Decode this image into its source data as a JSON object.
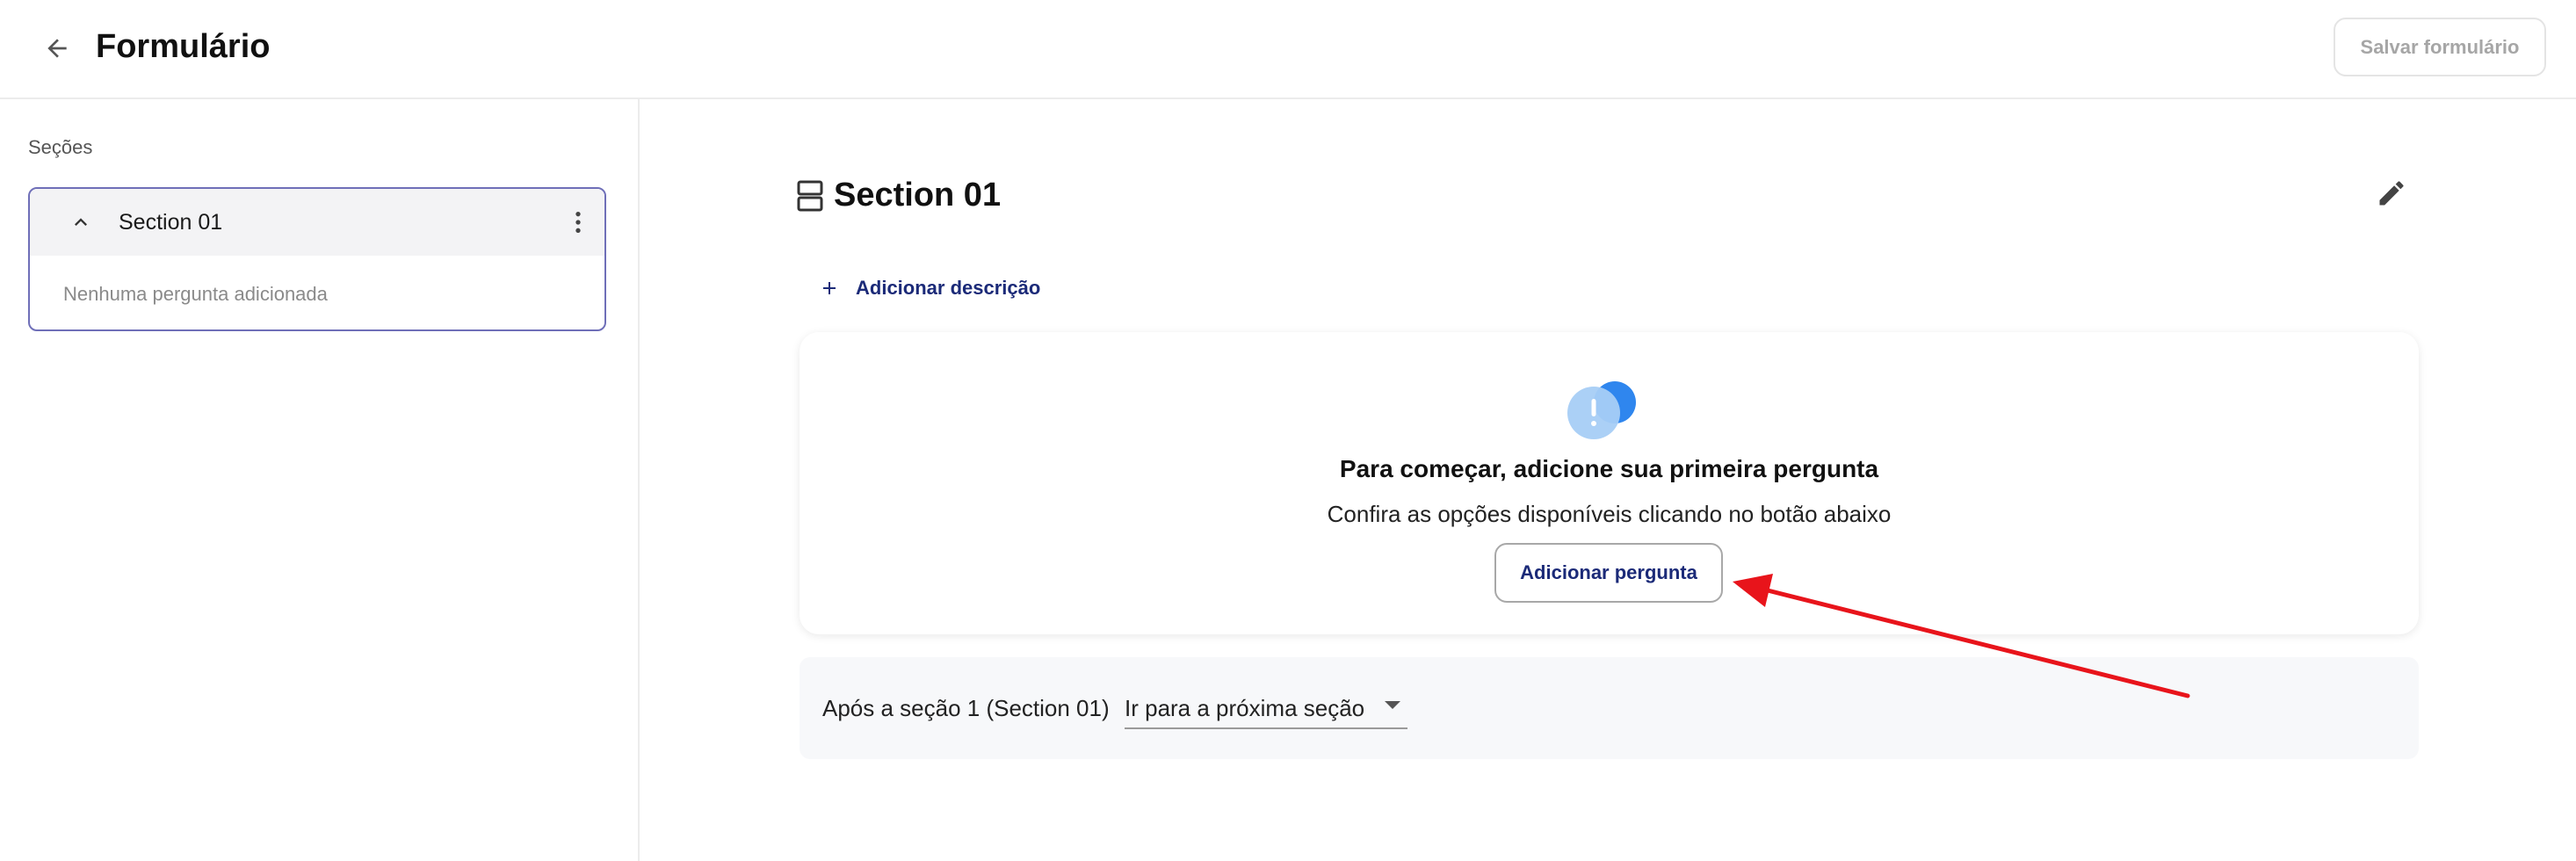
{
  "header": {
    "title": "Formulário",
    "back_icon": "arrow-left-icon",
    "save_label": "Salvar formulário"
  },
  "sidebar": {
    "heading": "Seções",
    "sections": [
      {
        "title": "Section 01",
        "empty_text": "Nenhuma pergunta adicionada",
        "expanded": true
      }
    ]
  },
  "main": {
    "section_title": "Section 01",
    "add_description_label": "Adicionar descrição",
    "empty_state": {
      "title": "Para começar, adicione sua primeira pergunta",
      "subtitle": "Confira as opções disponíveis clicando no botão abaixo",
      "button_label": "Adicionar pergunta"
    },
    "after_section": {
      "label": "Após a seção 1 (Section 01)",
      "selected_option": "Ir para a próxima seção"
    }
  },
  "colors": {
    "accent": "#1b2a78",
    "card_border": "#6f6fb8",
    "annotation_arrow": "#e8141b",
    "alert_light": "#a6cdf6",
    "alert_dark": "#2f86ee"
  }
}
